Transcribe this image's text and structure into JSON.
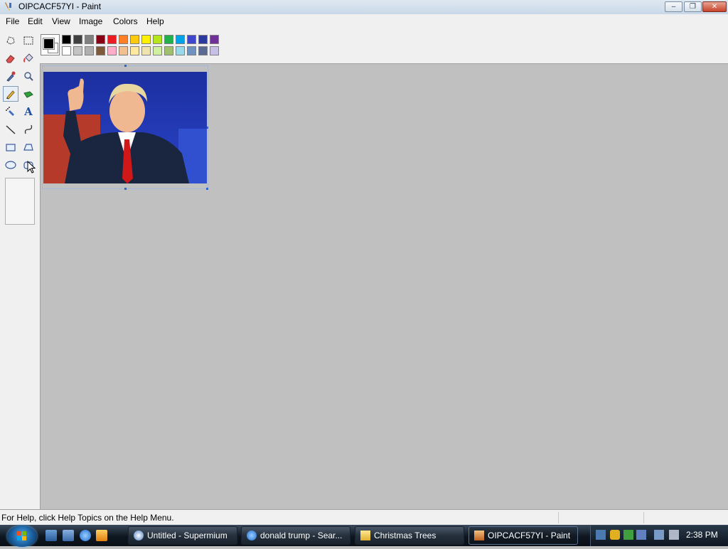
{
  "window": {
    "title": "OIPCACF57YI - Paint",
    "controls": {
      "minimize": "–",
      "maximize": "❐",
      "close": "✕"
    }
  },
  "menubar": {
    "items": [
      "File",
      "Edit",
      "View",
      "Image",
      "Colors",
      "Help"
    ]
  },
  "toolbox": {
    "tools": [
      {
        "name": "free-form-select-icon",
        "selected": false
      },
      {
        "name": "select-icon",
        "selected": false
      },
      {
        "name": "eraser-icon",
        "selected": false
      },
      {
        "name": "fill-bucket-icon",
        "selected": false
      },
      {
        "name": "pick-color-icon",
        "selected": false
      },
      {
        "name": "magnifier-icon",
        "selected": false
      },
      {
        "name": "pencil-icon",
        "selected": true
      },
      {
        "name": "brush-icon",
        "selected": false
      },
      {
        "name": "airbrush-icon",
        "selected": false
      },
      {
        "name": "text-icon",
        "selected": false
      },
      {
        "name": "line-icon",
        "selected": false
      },
      {
        "name": "curve-icon",
        "selected": false
      },
      {
        "name": "rectangle-icon",
        "selected": false
      },
      {
        "name": "polygon-icon",
        "selected": false
      },
      {
        "name": "ellipse-icon",
        "selected": false
      },
      {
        "name": "rounded-rectangle-icon",
        "selected": false
      }
    ],
    "text_tool_glyph": "A"
  },
  "colors": {
    "foreground": "#000000",
    "background": "#ffffff",
    "palette_top": [
      "#000000",
      "#404040",
      "#808080",
      "#880015",
      "#ed1c24",
      "#ff7f27",
      "#ffc90e",
      "#fff200",
      "#b5e61d",
      "#22b14c",
      "#00a2e8",
      "#3f48cc",
      "#2b3a9c",
      "#6f3198"
    ],
    "palette_bottom": [
      "#ffffff",
      "#c3c3c3",
      "#b0b0b0",
      "#7f5a3a",
      "#ffaec9",
      "#f0c090",
      "#ffe8a0",
      "#efe4b0",
      "#d0f0a0",
      "#a0c070",
      "#99d9ea",
      "#7092be",
      "#5a6a90",
      "#c8bfe7"
    ]
  },
  "statusbar": {
    "help_text": "For Help, click Help Topics on the Help Menu."
  },
  "taskbar": {
    "buttons": [
      {
        "label": "Untitled - Supermium",
        "icon": "supermium-icon",
        "active": false
      },
      {
        "label": "donald trump - Sear...",
        "icon": "internet-explorer-icon",
        "active": false
      },
      {
        "label": "Christmas Trees",
        "icon": "folder-icon",
        "active": false
      },
      {
        "label": "OIPCACF57YI - Paint",
        "icon": "paint-icon",
        "active": true
      }
    ],
    "clock": "2:38 PM"
  }
}
